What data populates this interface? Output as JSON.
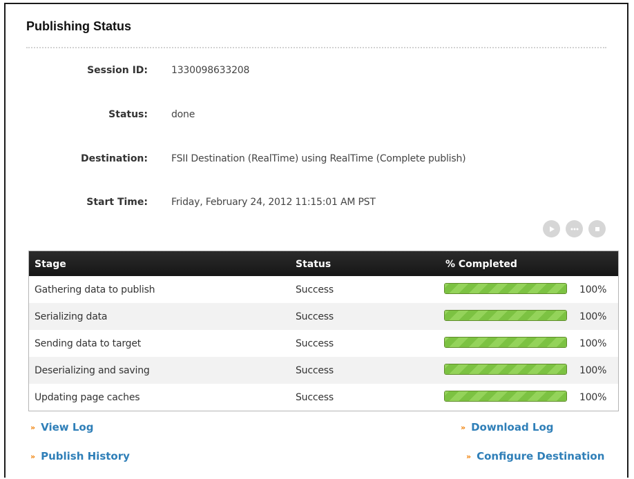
{
  "panel": {
    "title": "Publishing Status"
  },
  "fields": {
    "session_id": {
      "label": "Session ID:",
      "value": "1330098633208"
    },
    "status": {
      "label": "Status:",
      "value": "done"
    },
    "destination": {
      "label": "Destination:",
      "value": "FSII Destination (RealTime) using RealTime (Complete publish)"
    },
    "start_time": {
      "label": "Start Time:",
      "value": "Friday, February 24, 2012 11:15:01 AM PST"
    }
  },
  "controls": {
    "icons": [
      "play-icon",
      "pause-icon",
      "stop-icon"
    ]
  },
  "table": {
    "headers": [
      "Stage",
      "Status",
      "% Completed"
    ],
    "rows": [
      {
        "stage": "Gathering data to publish",
        "status": "Success",
        "progress": 100,
        "pct_label": "100%"
      },
      {
        "stage": "Serializing data",
        "status": "Success",
        "progress": 100,
        "pct_label": "100%"
      },
      {
        "stage": "Sending data to target",
        "status": "Success",
        "progress": 100,
        "pct_label": "100%"
      },
      {
        "stage": "Deserializing and saving",
        "status": "Success",
        "progress": 100,
        "pct_label": "100%"
      },
      {
        "stage": "Updating page caches",
        "status": "Success",
        "progress": 100,
        "pct_label": "100%"
      }
    ]
  },
  "links": {
    "view_log": "View Log",
    "download_log": "Download Log",
    "publish_history": "Publish History",
    "configure_destination": "Configure Destination"
  },
  "colors": {
    "link": "#2f7fb8",
    "link_arrow": "#f07d00",
    "progress": "#7cc242",
    "header_bg": "#1f1f1f"
  }
}
